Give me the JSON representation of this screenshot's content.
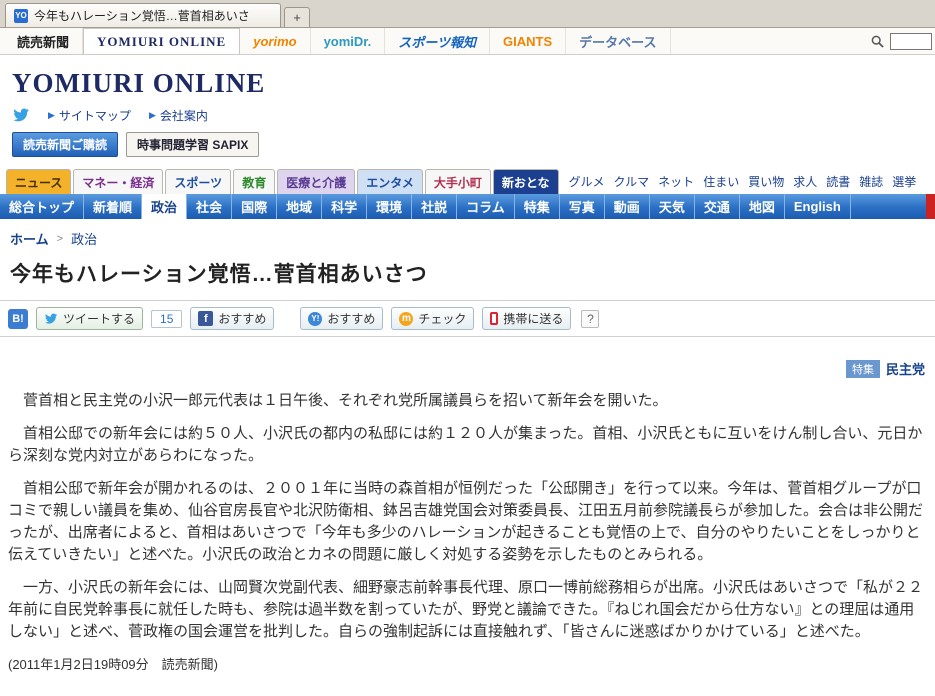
{
  "browser": {
    "tab_title": "今年もハレーション覚悟…菅首相あいさ",
    "new_tab": "+"
  },
  "brand_bar": {
    "items": [
      {
        "label": "読売新聞",
        "color": "#222222"
      },
      {
        "label": "YOMIURI ONLINE",
        "color": "#1e2a63"
      },
      {
        "label": "yorimo",
        "color": "#f08300"
      },
      {
        "label": "yomiDr.",
        "color": "#2e9ac0"
      },
      {
        "label": "スポーツ報知",
        "color": "#1565c0"
      },
      {
        "label": "GIANTS",
        "color": "#f08300"
      },
      {
        "label": "データベース",
        "color": "#5577aa"
      }
    ]
  },
  "header": {
    "logo": "YOMIURI ONLINE",
    "sitemap": "サイトマップ",
    "company": "会社案内",
    "subscribe": "読売新聞ご購読",
    "sapix": "時事問題学習 SAPIX"
  },
  "category_nav": {
    "tabs": [
      {
        "label": "ニュース",
        "bg": "#f3b229",
        "color": "#402f00"
      },
      {
        "label": "マネー・経済",
        "bg": "#f7f7f7",
        "color": "#7a2f8f"
      },
      {
        "label": "スポーツ",
        "bg": "#f7f7f7",
        "color": "#1d4e9e"
      },
      {
        "label": "教育",
        "bg": "#f7f7f7",
        "color": "#2c8a2c"
      },
      {
        "label": "医療と介護",
        "bg": "#ded4ee",
        "color": "#5a3a93"
      },
      {
        "label": "エンタメ",
        "bg": "#cfe0f4",
        "color": "#1d4e9e"
      },
      {
        "label": "大手小町",
        "bg": "#f7f7f7",
        "color": "#b03050"
      },
      {
        "label": "新おとな",
        "bg": "#1d3f8f",
        "color": "#ffffff"
      }
    ],
    "links": [
      "グルメ",
      "クルマ",
      "ネット",
      "住まい",
      "買い物",
      "求人",
      "読書",
      "雑誌",
      "選挙"
    ]
  },
  "section_nav": {
    "items": [
      "総合トップ",
      "新着順",
      "政治",
      "社会",
      "国際",
      "地域",
      "科学",
      "環境",
      "社説",
      "コラム",
      "特集",
      "写真",
      "動画",
      "天気",
      "交通",
      "地図",
      "English"
    ],
    "active": "政治"
  },
  "breadcrumb": {
    "home": "ホーム",
    "separator": ">",
    "current": "政治"
  },
  "social": {
    "hatena": "B!",
    "tweet_label": "ツイートする",
    "tweet_count": "15",
    "facebook_icon": "f",
    "facebook_label": "おすすめ",
    "yahoo_icon": "Y!",
    "yahoo_label": "おすすめ",
    "mixi_icon": "m",
    "mixi_label": "チェック",
    "mobile_label": "携帯に送る",
    "help": "?"
  },
  "related": {
    "badge": "特集",
    "link": "民主党"
  },
  "article": {
    "title": "今年もハレーション覚悟…菅首相あいさつ",
    "paragraphs": [
      "　菅首相と民主党の小沢一郎元代表は１日午後、それぞれ党所属議員らを招いて新年会を開いた。",
      "　首相公邸での新年会には約５０人、小沢氏の都内の私邸には約１２０人が集まった。首相、小沢氏ともに互いをけん制し合い、元日から深刻な党内対立があらわになった。",
      "　首相公邸で新年会が開かれるのは、２００１年に当時の森首相が恒例だった「公邸開き」を行って以来。今年は、菅首相グループが口コミで親しい議員を集め、仙谷官房長官や北沢防衛相、鉢呂吉雄党国会対策委員長、江田五月前参院議長らが参加した。会合は非公開だったが、出席者によると、首相はあいさつで「今年も多少のハレーションが起きることも覚悟の上で、自分のやりたいことをしっかりと伝えていきたい」と述べた。小沢氏の政治とカネの問題に厳しく対処する姿勢を示したものとみられる。",
      "　一方、小沢氏の新年会には、山岡賢次党副代表、細野豪志前幹事長代理、原口一博前総務相らが出席。小沢氏はあいさつで「私が２２年前に自民党幹事長に就任した時も、参院は過半数を割っていたが、野党と議論できた。『ねじれ国会だから仕方ない』との理屈は通用しない」と述べ、菅政権の国会運営を批判した。自らの強制起訴には直接触れず、「皆さんに迷惑ばかりかけている」と述べた。"
    ],
    "dateline": "(2011年1月2日19時09分　読売新聞)"
  }
}
